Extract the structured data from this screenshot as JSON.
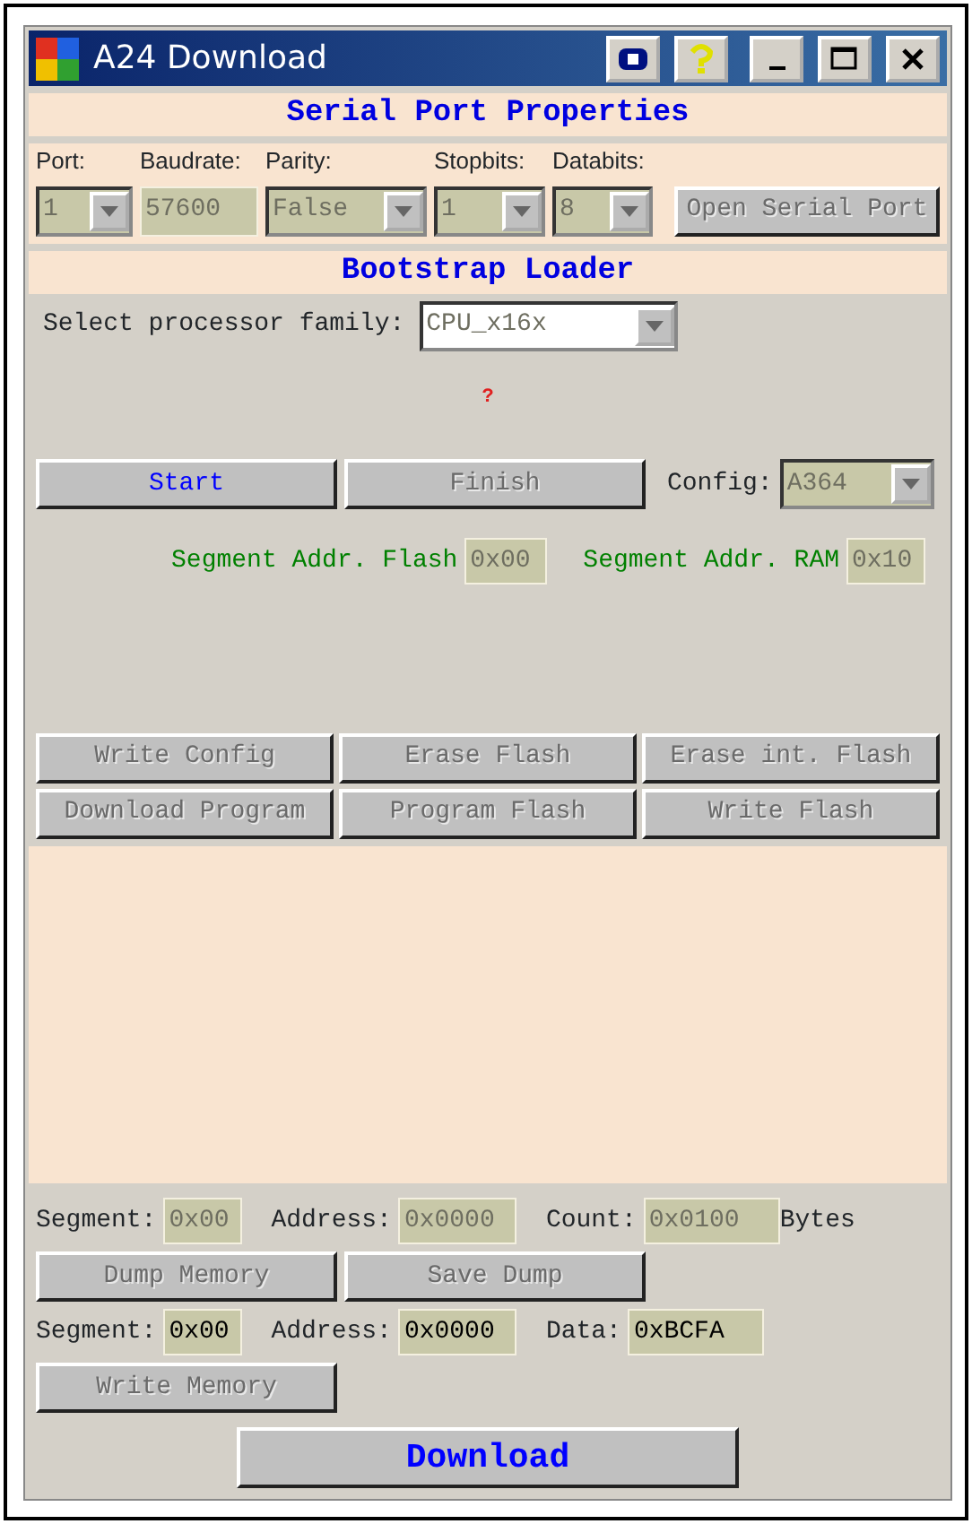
{
  "window": {
    "title": "A24 Download"
  },
  "serial_port": {
    "heading": "Serial Port Properties",
    "fields": [
      {
        "label": "Port:",
        "value": "1",
        "kind": "dropdown",
        "disabled": true
      },
      {
        "label": "Baudrate:",
        "value": "57600",
        "kind": "text",
        "disabled": true
      },
      {
        "label": "Parity:",
        "value": "False",
        "kind": "dropdown",
        "disabled": true
      },
      {
        "label": "Stopbits:",
        "value": "1",
        "kind": "dropdown",
        "disabled": true
      },
      {
        "label": "Databits:",
        "value": "8",
        "kind": "dropdown",
        "disabled": true
      }
    ],
    "open_button": {
      "label": "Open Serial Port",
      "disabled": true
    }
  },
  "bootstrap": {
    "heading": "Bootstrap Loader",
    "processor_label": "Select processor family:",
    "processor": {
      "value": "CPU_x16x",
      "disabled": true
    },
    "status": "?",
    "start_button": {
      "label": "Start",
      "disabled": false
    },
    "finish_button": {
      "label": "Finish",
      "disabled": true
    },
    "config_label": "Config:",
    "config": {
      "value": "A364",
      "disabled": true
    },
    "segments": [
      {
        "label": "Segment Addr. Flash",
        "value": "0x00",
        "disabled": true
      },
      {
        "label": "Segment Addr. RAM",
        "value": "0x10",
        "disabled": true
      }
    ],
    "actions": [
      {
        "label": "Write Config",
        "disabled": true
      },
      {
        "label": "Erase Flash",
        "disabled": true
      },
      {
        "label": "Erase int. Flash",
        "disabled": true
      },
      {
        "label": "Download Program",
        "disabled": true
      },
      {
        "label": "Program Flash",
        "disabled": true
      },
      {
        "label": "Write Flash",
        "disabled": true
      }
    ]
  },
  "memory": {
    "dump_fields": [
      {
        "label": "Segment:",
        "value": "0x00",
        "disabled": true
      },
      {
        "label": "Address:",
        "value": "0x0000",
        "disabled": true
      },
      {
        "label": "Count:",
        "value": "0x0100",
        "disabled": true
      }
    ],
    "unit": "Bytes",
    "dump_buttons": [
      {
        "label": "Dump Memory",
        "disabled": true
      },
      {
        "label": "Save Dump",
        "disabled": true
      }
    ],
    "write_fields": [
      {
        "label": "Segment:",
        "value": "0x00",
        "disabled": false
      },
      {
        "label": "Address:",
        "value": "0x0000",
        "disabled": false
      },
      {
        "label": "Data:",
        "value": "0xBCFA",
        "disabled": false
      }
    ],
    "write_button": {
      "label": "Write Memory",
      "disabled": true
    }
  },
  "download_button": {
    "label": "Download",
    "disabled": false
  }
}
